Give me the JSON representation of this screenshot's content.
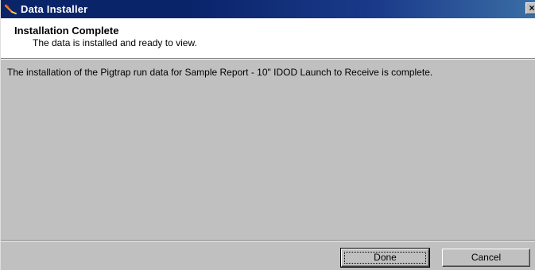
{
  "window": {
    "title": "Data Installer",
    "close_glyph": "×"
  },
  "header": {
    "title": "Installation Complete",
    "subtitle": "The data is installed and ready to view."
  },
  "body": {
    "message": "The installation of the Pigtrap run data for Sample Report - 10\" IDOD Launch to Receive is complete."
  },
  "buttons": {
    "done_label": "Done",
    "cancel_label": "Cancel"
  },
  "colors": {
    "titlebar_start": "#0a246a",
    "titlebar_end": "#3a6ea5",
    "face": "#c0c0c0",
    "header_bg": "#ffffff"
  },
  "icons": {
    "app": "installer-app-icon",
    "close": "close-icon"
  }
}
